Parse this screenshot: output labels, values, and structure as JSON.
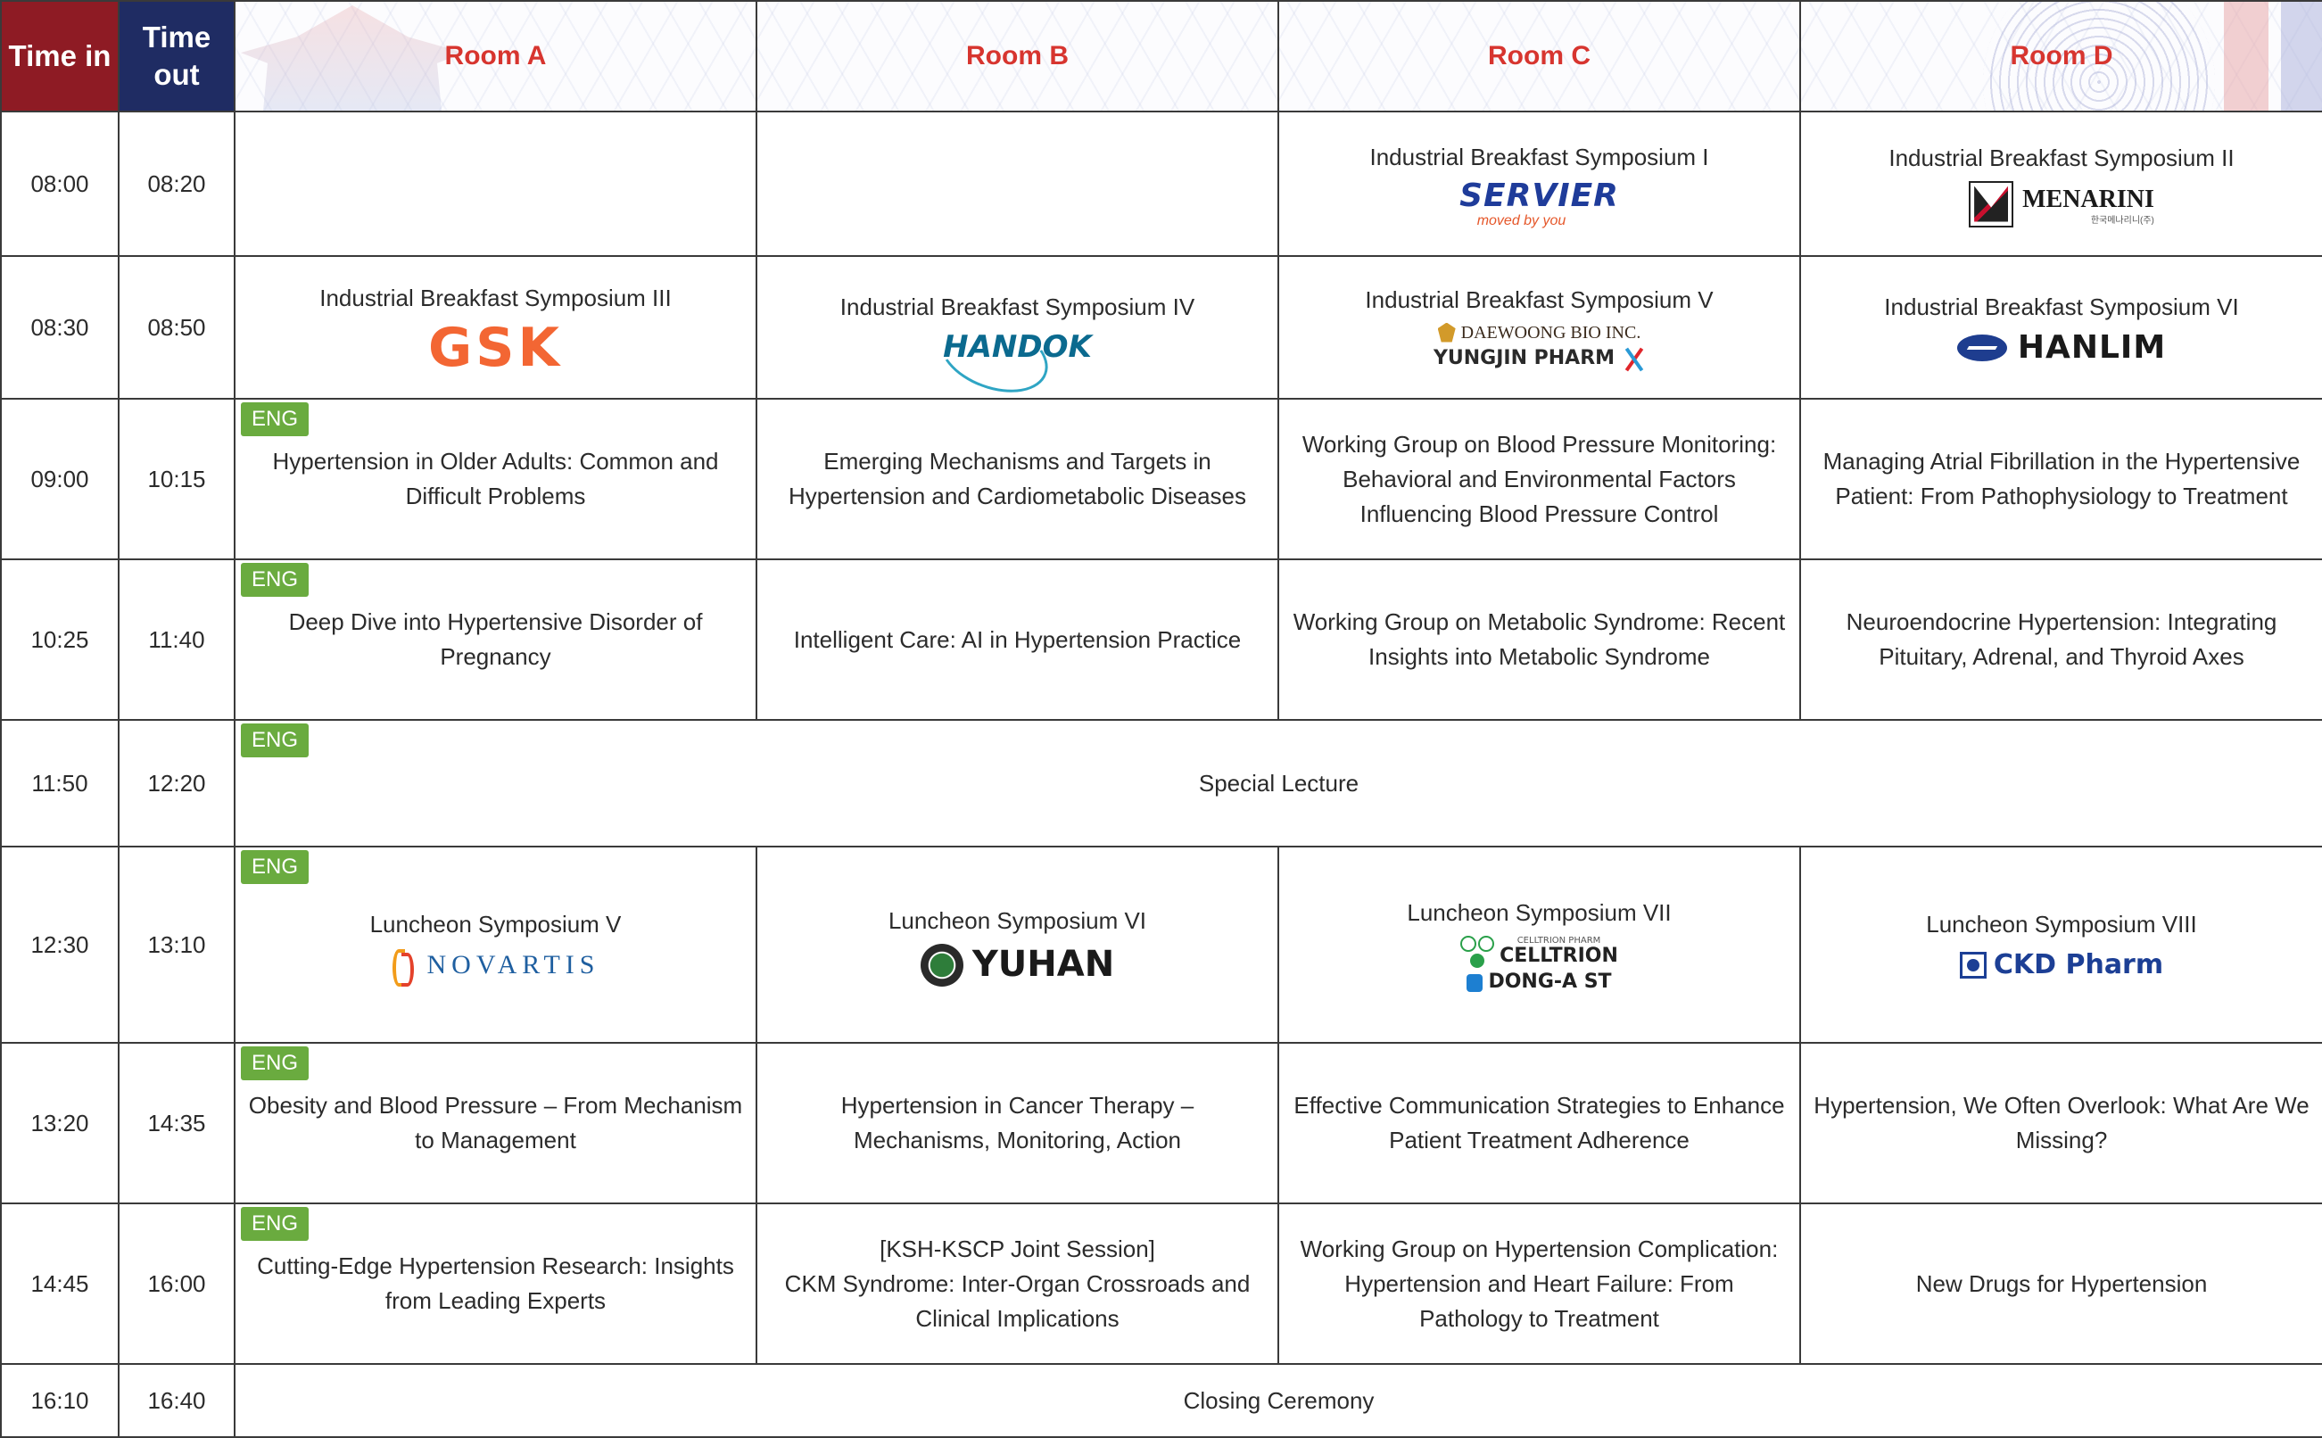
{
  "header": {
    "time_in": "Time in",
    "time_out": "Time out",
    "rooms": [
      "Room A",
      "Room B",
      "Room C",
      "Room D"
    ]
  },
  "badge": "ENG",
  "rows": [
    {
      "time_in": "08:00",
      "time_out": "08:20",
      "c": {
        "title": "Industrial Breakfast Symposium I",
        "logo_text": "SERVIER",
        "logo_sub": "moved by you"
      },
      "d": {
        "title": "Industrial Breakfast Symposium II",
        "logo_text": "MENARINI",
        "logo_sub": "한국메나리니(주)"
      }
    },
    {
      "time_in": "08:30",
      "time_out": "08:50",
      "a": {
        "title": "Industrial Breakfast Symposium III",
        "logo_text": "GSK"
      },
      "b": {
        "title": "Industrial Breakfast Symposium IV",
        "logo_text": "HANDOK"
      },
      "c": {
        "title": "Industrial Breakfast Symposium V",
        "logo_text": "DAEWOONG BIO INC.",
        "logo_text2": "YUNGJIN PHARM"
      },
      "d": {
        "title": "Industrial Breakfast Symposium VI",
        "logo_text": "HANLIM"
      }
    },
    {
      "time_in": "09:00",
      "time_out": "10:15",
      "a": {
        "title": "Hypertension in Older Adults: Common and Difficult Problems"
      },
      "b": {
        "title": "Emerging Mechanisms and Targets in Hypertension and Cardiometabolic Diseases"
      },
      "c": {
        "title": "Working Group on Blood Pressure Monitoring: Behavioral and Environmental Factors Influencing Blood Pressure Control"
      },
      "d": {
        "title": "Managing Atrial Fibrillation in the Hypertensive Patient: From Pathophysiology to Treatment"
      }
    },
    {
      "time_in": "10:25",
      "time_out": "11:40",
      "a": {
        "title": "Deep Dive into Hypertensive Disorder of Pregnancy"
      },
      "b": {
        "title": "Intelligent Care: AI in Hypertension Practice"
      },
      "c": {
        "title": "Working Group on Metabolic Syndrome: Recent Insights into Metabolic Syndrome"
      },
      "d": {
        "title": "Neuroendocrine Hypertension: Integrating Pituitary, Adrenal, and Thyroid Axes"
      }
    },
    {
      "time_in": "11:50",
      "time_out": "12:20",
      "span": {
        "title": "Special Lecture"
      }
    },
    {
      "time_in": "12:30",
      "time_out": "13:10",
      "a": {
        "title": "Luncheon Symposium V",
        "logo_text": "NOVARTIS"
      },
      "b": {
        "title": "Luncheon Symposium VI",
        "logo_text": "YUHAN"
      },
      "c": {
        "title": "Luncheon Symposium VII",
        "logo_top": "CELLTRION PHARM",
        "logo_text": "CELLTRION",
        "logo_text2": "DONG-A ST"
      },
      "d": {
        "title": "Luncheon Symposium VIII",
        "logo_text": "CKD Pharm"
      }
    },
    {
      "time_in": "13:20",
      "time_out": "14:35",
      "a": {
        "title": "Obesity and Blood Pressure – From Mechanism to Management"
      },
      "b": {
        "title": "Hypertension in Cancer Therapy – Mechanisms, Monitoring, Action"
      },
      "c": {
        "title": "Effective Communication Strategies to Enhance Patient Treatment Adherence"
      },
      "d": {
        "title": "Hypertension, We Often Overlook: What Are We Missing?"
      }
    },
    {
      "time_in": "14:45",
      "time_out": "16:00",
      "a": {
        "title": "Cutting-Edge Hypertension Research: Insights from Leading Experts"
      },
      "b": {
        "title_line1": "[KSH-KSCP Joint Session]",
        "title": "CKM Syndrome: Inter-Organ Crossroads and Clinical Implications"
      },
      "c": {
        "title": "Working Group on Hypertension Complication: Hypertension and Heart Failure: From Pathology to Treatment"
      },
      "d": {
        "title": "New Drugs for Hypertension"
      }
    },
    {
      "time_in": "16:10",
      "time_out": "16:40",
      "span": {
        "title": "Closing Ceremony"
      }
    }
  ],
  "colors": {
    "time_in_header": "#8e1b24",
    "time_out_header": "#1f2c63",
    "room_header_text": "#d7352f",
    "eng_badge": "#6aab3f",
    "border": "#3a3a3a"
  }
}
